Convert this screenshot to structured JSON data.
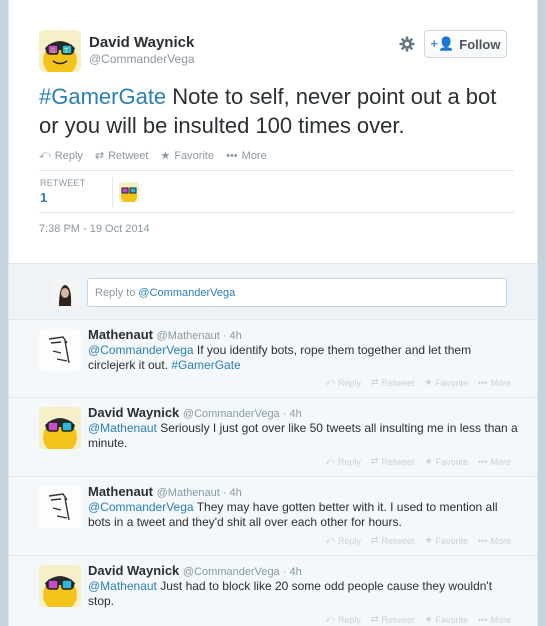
{
  "main_tweet": {
    "author_name": "David Waynick",
    "author_handle": "@CommanderVega",
    "follow_label": "Follow",
    "text_hashtag": "#GamerGate",
    "text_body": " Note to self, never point out a bot or you will be insulted 100 times over.",
    "actions": {
      "reply": "Reply",
      "retweet": "Retweet",
      "favorite": "Favorite",
      "more": "More"
    },
    "retweet_label": "RETWEET",
    "retweet_count": "1",
    "timestamp": "7:38 PM - 19 Oct 2014"
  },
  "reply_box": {
    "placeholder_prefix": "Reply to ",
    "placeholder_mention": "@CommanderVega"
  },
  "replies": [
    {
      "name": "Mathenaut",
      "handle": "@Mathenaut · 4h",
      "mention": "@CommanderVega",
      "text": " If you identify bots, rope them together and let them circlejerk it out. ",
      "hashtag": "#GamerGate"
    },
    {
      "name": "David Waynick",
      "handle": "@CommanderVega · 4h",
      "mention": "@Mathenaut",
      "text": " Seriously I just got over like 50 tweets all insulting me in less than a minute.",
      "hashtag": ""
    },
    {
      "name": "Mathenaut",
      "handle": "@Mathenaut · 4h",
      "mention": "@CommanderVega",
      "text": " They may have gotten better with it. I used to mention all bots in a tweet and they'd shit all over each other for hours.",
      "hashtag": ""
    },
    {
      "name": "David Waynick",
      "handle": "@CommanderVega · 4h",
      "mention": "@Mathenaut",
      "text": " Just had to block like 20 some odd people cause they wouldn't stop.",
      "hashtag": ""
    }
  ],
  "reply_actions": {
    "reply": "Reply",
    "retweet": "Retweet",
    "favorite": "Favorite",
    "more": "More"
  },
  "icons": {
    "reply": "reply-arrow-icon",
    "retweet": "retweet-icon",
    "favorite": "star-icon",
    "more": "ellipsis-icon",
    "gear": "gear-icon",
    "follow": "add-user-icon"
  },
  "colors": {
    "link": "#2a7fb5",
    "muted": "#8899a6",
    "background": "#c7d3dc"
  }
}
